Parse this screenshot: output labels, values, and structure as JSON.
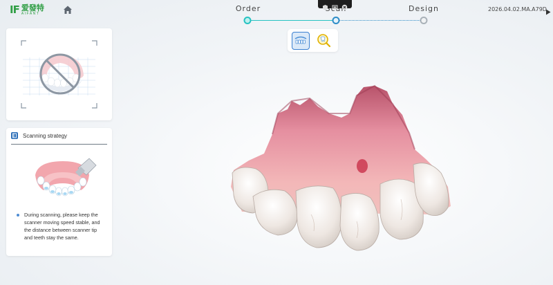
{
  "header": {
    "logo_mark": "IF",
    "logo_cn": "爱發特",
    "logo_sub": "AIFANT",
    "steps": [
      {
        "label": "Order",
        "state": "done"
      },
      {
        "label": "Scan",
        "state": "active"
      },
      {
        "label": "Design",
        "state": "todo"
      }
    ],
    "device_id": "2026.04.02.MA.A79D"
  },
  "strategy": {
    "title": "Scanning strategy",
    "tip": "During scanning, please keep the scanner moving speed stable, and the distance between scanner tip and teeth stay the same."
  },
  "colors": {
    "accent_green": "#2f9e44",
    "step_done": "#25c2c2",
    "step_active": "#2d8cc7",
    "step_todo": "#a9b1b8",
    "active_button": "#3a7fd0"
  },
  "icons": [
    "home-icon",
    "shield-icon",
    "upload-icon",
    "close-icon",
    "play-icon",
    "teeth-view-icon",
    "tooth-zoom-icon",
    "no-denture-icon"
  ]
}
